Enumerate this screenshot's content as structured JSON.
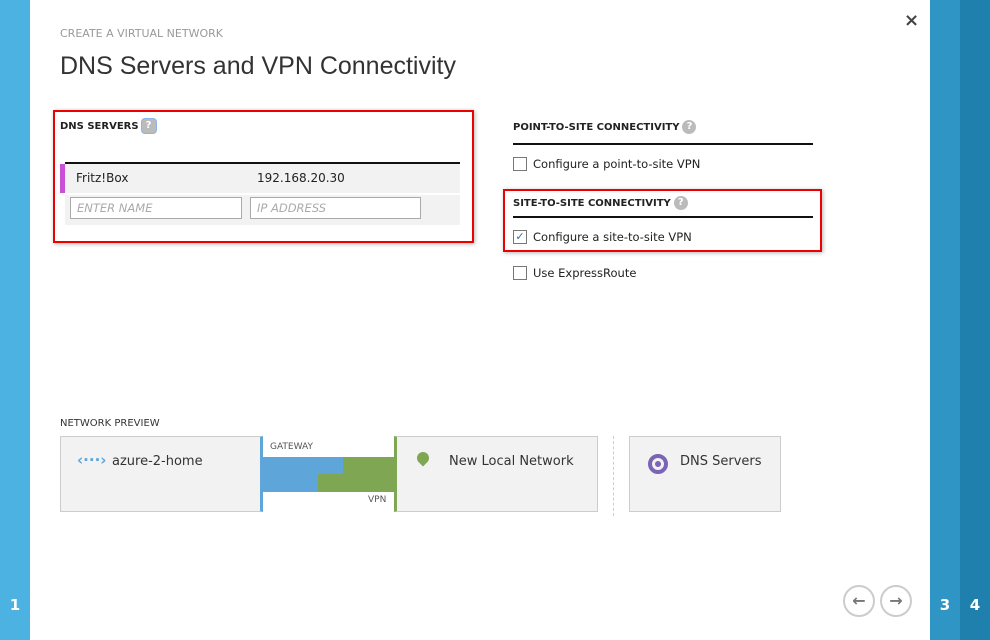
{
  "wizard": {
    "subtitle": "CREATE A VIRTUAL NETWORK",
    "title": "DNS Servers and VPN Connectivity",
    "steps": [
      "1",
      "3",
      "4"
    ]
  },
  "dns": {
    "header": "DNS SERVERS",
    "help": "?",
    "rows": [
      {
        "name": "Fritz!Box",
        "ip": "192.168.20.30"
      }
    ],
    "name_placeholder": "ENTER NAME",
    "ip_placeholder": "IP ADDRESS"
  },
  "p2s": {
    "header": "POINT-TO-SITE CONNECTIVITY",
    "option": "Configure a point-to-site VPN",
    "checked": false
  },
  "s2s": {
    "header": "SITE-TO-SITE CONNECTIVITY",
    "option": "Configure a site-to-site VPN",
    "checked": true
  },
  "expressroute": {
    "option": "Use ExpressRoute",
    "checked": false
  },
  "preview": {
    "label": "NETWORK PREVIEW",
    "vnet": "azure-2-home",
    "gateway": "GATEWAY",
    "vpn": "VPN",
    "local": "New Local Network",
    "dns": "DNS Servers"
  },
  "colors": {
    "left_strip": "#4cb2e2",
    "strip3": "#2f95c4",
    "strip4": "#1f80ad",
    "gateway": "#5ea6da",
    "vpn": "#7fa653",
    "dns_accent": "#c94fd6",
    "dns_icon": "#7b64b5"
  },
  "close": "×",
  "nav": {
    "back": "←",
    "next": "→"
  }
}
